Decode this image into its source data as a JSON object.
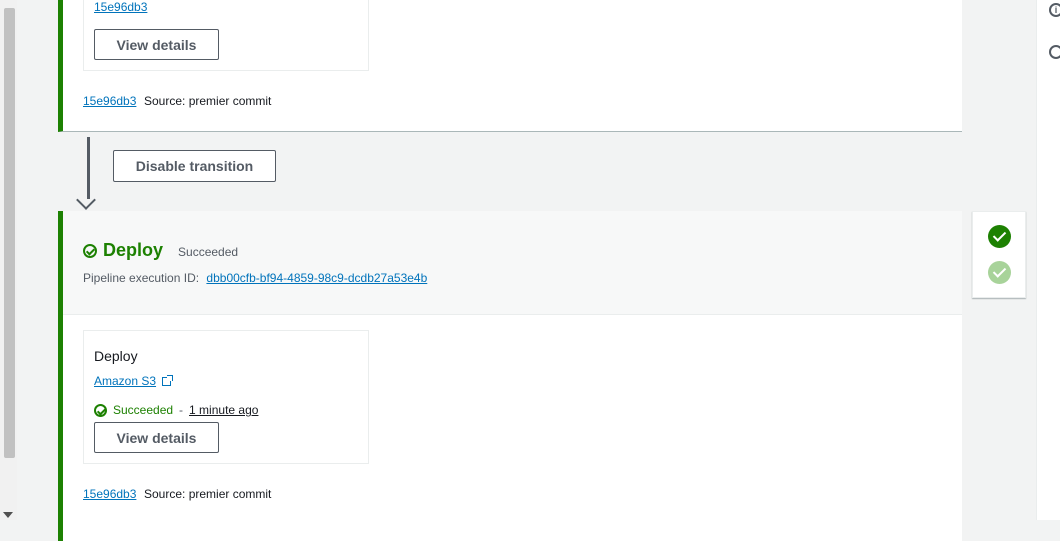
{
  "top_stage": {
    "action_commit_link": "15e96db3",
    "view_details_label": "View details",
    "commit_id": "15e96db3",
    "source_text": "Source: premier commit"
  },
  "transition": {
    "button_label": "Disable transition"
  },
  "deploy_stage": {
    "name": "Deploy",
    "status": "Succeeded",
    "execution_label": "Pipeline execution ID:",
    "execution_id": "dbb00cfb-bf94-4859-98c9-dcdb27a53e4b",
    "action": {
      "name": "Deploy",
      "provider": "Amazon S3",
      "status": "Succeeded",
      "separator": "-",
      "time": "1 minute ago",
      "view_details_label": "View details"
    },
    "commit_id": "15e96db3",
    "source_text": "Source: premier commit"
  },
  "status_panel": {
    "items": [
      "succeeded",
      "succeeded"
    ]
  },
  "colors": {
    "success": "#1d8102",
    "success_light": "#a8d39a",
    "link": "#0073bb",
    "background": "#f2f3f3"
  },
  "icons": {
    "right_rail": [
      "info-icon",
      "settings-icon"
    ],
    "stage_status": "success-check-icon",
    "external_link": "external-link-icon"
  }
}
